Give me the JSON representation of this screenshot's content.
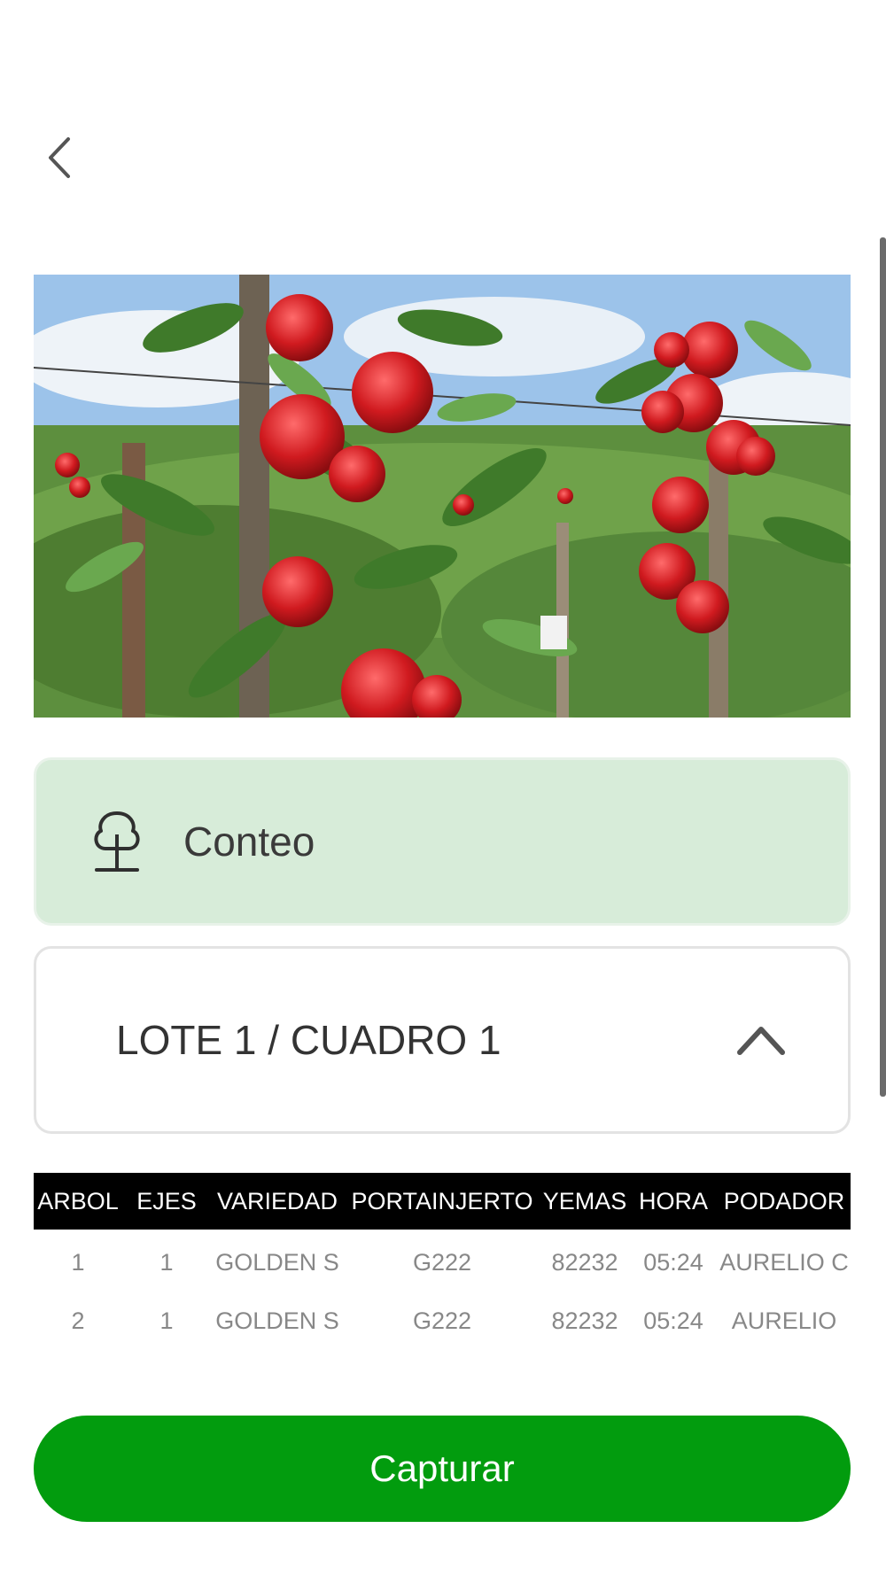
{
  "header": {
    "back_icon": "chevron-left-icon"
  },
  "hero": {
    "alt": "apple-tree-photo"
  },
  "activity": {
    "icon": "tree-icon",
    "label": "Conteo",
    "bg_color": "#d7ecd9"
  },
  "selector": {
    "label": "LOTE 1 / CUADRO 1",
    "icon": "chevron-up-icon"
  },
  "table": {
    "columns": [
      "ARBOL",
      "EJES",
      "VARIEDAD",
      "PORTAINJERTO",
      "YEMAS",
      "HORA",
      "PODADOR"
    ],
    "rows": [
      [
        "1",
        "1",
        "GOLDEN S",
        "G222",
        "82232",
        "05:24",
        "AURELIO C"
      ],
      [
        "2",
        "1",
        "GOLDEN S",
        "G222",
        "82232",
        "05:24",
        "AURELIO"
      ]
    ]
  },
  "actions": {
    "capture_label": "Capturar",
    "capture_color": "#029c0e"
  }
}
